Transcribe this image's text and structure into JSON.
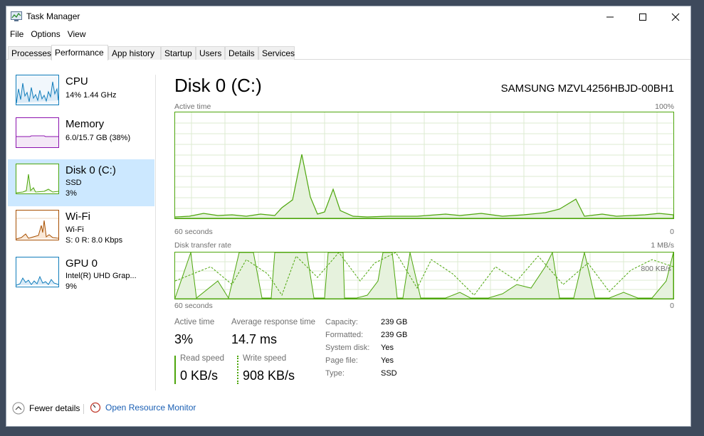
{
  "window": {
    "title": "Task Manager"
  },
  "menu": [
    "File",
    "Options",
    "View"
  ],
  "tabs": [
    "Processes",
    "Performance",
    "App history",
    "Startup",
    "Users",
    "Details",
    "Services"
  ],
  "sidebar": {
    "items": [
      {
        "title": "CPU",
        "sub1": "14%  1.44 GHz",
        "sub2": ""
      },
      {
        "title": "Memory",
        "sub1": "6.0/15.7 GB (38%)",
        "sub2": ""
      },
      {
        "title": "Disk 0 (C:)",
        "sub1": "SSD",
        "sub2": "3%"
      },
      {
        "title": "Wi-Fi",
        "sub1": "Wi-Fi",
        "sub2": "S: 0 R: 8.0 Kbps"
      },
      {
        "title": "GPU 0",
        "sub1": "Intel(R) UHD Grap...",
        "sub2": "9%"
      }
    ]
  },
  "main": {
    "title": "Disk 0 (C:)",
    "model": "SAMSUNG MZVL4256HBJD-00BH1",
    "graph1": {
      "label": "Active time",
      "max": "100%",
      "time": "60 seconds",
      "min": "0"
    },
    "graph2": {
      "label": "Disk transfer rate",
      "max": "1 MB/s",
      "time": "60 seconds",
      "min": "0",
      "mid": "800 KB/s"
    },
    "stats": {
      "active_time_label": "Active time",
      "active_time_value": "3%",
      "avg_resp_label": "Average response time",
      "avg_resp_value": "14.7 ms",
      "read_label": "Read speed",
      "read_value": "0 KB/s",
      "write_label": "Write speed",
      "write_value": "908 KB/s"
    },
    "properties": [
      {
        "label": "Capacity:",
        "value": "239 GB"
      },
      {
        "label": "Formatted:",
        "value": "239 GB"
      },
      {
        "label": "System disk:",
        "value": "Yes"
      },
      {
        "label": "Page file:",
        "value": "Yes"
      },
      {
        "label": "Type:",
        "value": "SSD"
      }
    ]
  },
  "footer": {
    "fewer": "Fewer details",
    "monitor": "Open Resource Monitor"
  },
  "colors": {
    "accent": "#4da60c",
    "grid": "#d9ead3",
    "fill": "#e6f2dd",
    "selected": "#cce8ff",
    "link": "#1a5fb4"
  }
}
